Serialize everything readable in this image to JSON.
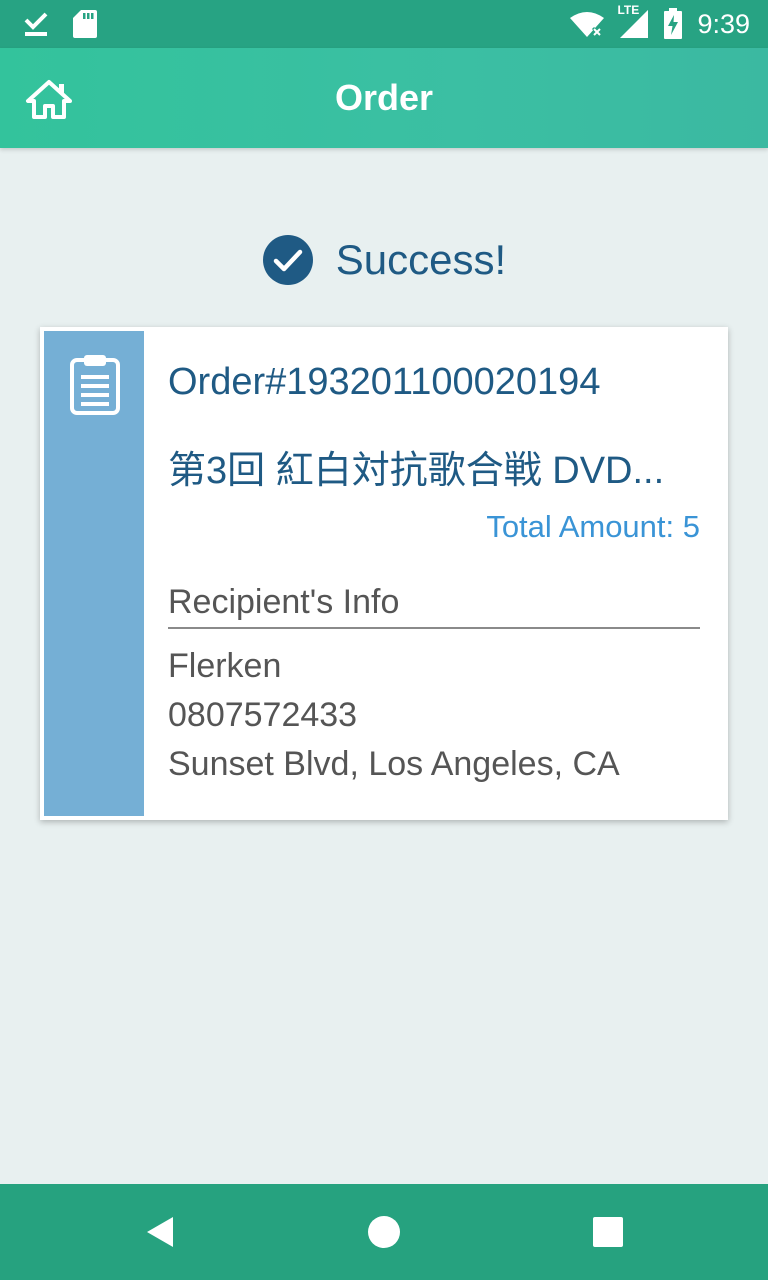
{
  "status_bar": {
    "time": "9:39",
    "network_label": "LTE",
    "icons": [
      "download-done-icon",
      "sd-card-icon",
      "wifi-icon",
      "signal-icon",
      "battery-charging-icon"
    ]
  },
  "app_bar": {
    "title": "Order",
    "home_icon": "home-icon"
  },
  "success": {
    "icon": "check-circle-icon",
    "text": "Success!"
  },
  "order_card": {
    "icon": "clipboard-icon",
    "order_number": "Order#193201100020194",
    "product_name": "第3回 紅白対抗歌合戦 DVD...",
    "total_amount": "Total Amount: 5",
    "recipient_header": "Recipient's Info",
    "recipient_name": "Flerken",
    "recipient_phone": "0807572433",
    "recipient_address": "Sunset Blvd, Los Angeles, CA"
  },
  "nav_bar": {
    "buttons": [
      "back-icon",
      "home-circle-icon",
      "recents-icon"
    ]
  },
  "colors": {
    "status_bar": "#27a383",
    "app_bar": "#33c39c",
    "background": "#e8f0f0",
    "title_blue": "#1f5a84",
    "amount_blue": "#3a94d6",
    "card_stripe": "#75afd5",
    "nav_bar": "#26a27f"
  }
}
